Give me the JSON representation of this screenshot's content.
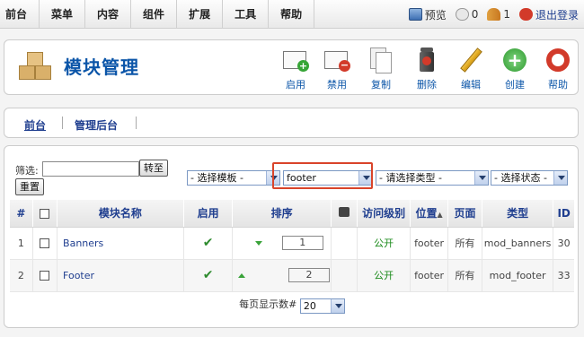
{
  "topmenu": [
    "前台",
    "菜单",
    "内容",
    "组件",
    "扩展",
    "工具",
    "帮助"
  ],
  "status": {
    "preview": "预览",
    "messages": "0",
    "users": "1",
    "logout": "退出登录"
  },
  "title": "模块管理",
  "toolbar": [
    "启用",
    "禁用",
    "复制",
    "删除",
    "编辑",
    "创建",
    "帮助"
  ],
  "submenu": [
    "前台",
    "管理后台"
  ],
  "filter": {
    "label": "筛选:",
    "value": "",
    "go": "转至",
    "reset": "重置"
  },
  "selects": {
    "template": "- 选择模板 -",
    "position": "footer",
    "type": "- 请选择类型 -",
    "state": "- 选择状态 -"
  },
  "columns": [
    "#",
    "",
    "模块名称",
    "启用",
    "排序",
    "",
    "访问级别",
    "位置",
    "页面",
    "类型",
    "ID"
  ],
  "rows": [
    {
      "num": "1",
      "name": "Banners",
      "order": "1",
      "access": "公开",
      "position": "footer",
      "pages": "所有",
      "type": "mod_banners",
      "id": "30"
    },
    {
      "num": "2",
      "name": "Footer",
      "order": "2",
      "access": "公开",
      "position": "footer",
      "pages": "所有",
      "type": "mod_footer",
      "id": "33"
    }
  ],
  "pagination": {
    "label": "每页显示数#",
    "value": "20"
  },
  "colors": {
    "link": "#1f3e8f",
    "highlight": "#d9442a",
    "published": "#1a8a1a"
  }
}
